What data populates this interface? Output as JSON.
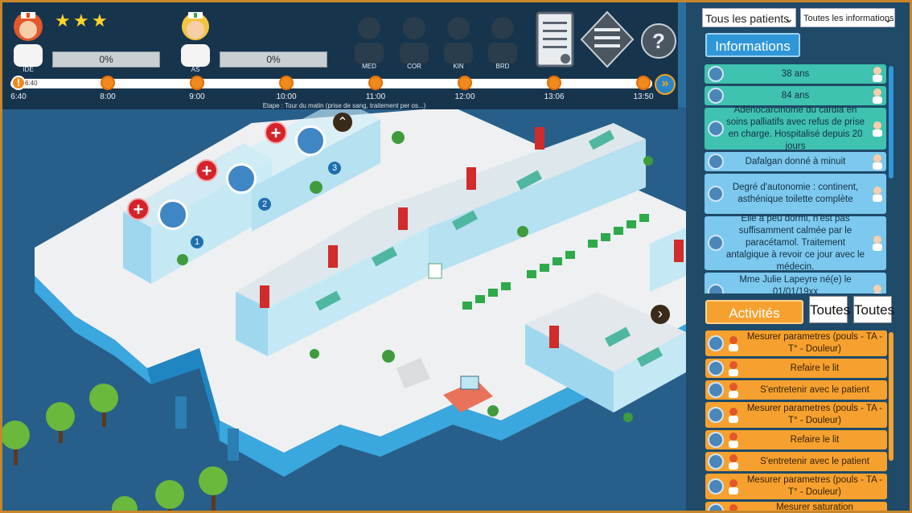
{
  "hud": {
    "staff": [
      {
        "code": "IDE",
        "progress": "0%"
      },
      {
        "code": "AS",
        "progress": "0%"
      }
    ],
    "stars": [
      "★",
      "★",
      "★"
    ],
    "consultants": [
      "MED",
      "COR",
      "KIN",
      "BRD"
    ],
    "icons": [
      "checklist-icon",
      "list-diamond-icon",
      "help-icon"
    ],
    "help_label": "?",
    "timeline": {
      "current_marker": "!",
      "current_time": "6:40",
      "ticks": [
        "6:40",
        "8:00",
        "9:00",
        "10:00",
        "11:00",
        "12:00",
        "13:06",
        "13:50"
      ],
      "stage": "Etape : Tour du matin (prise de sang, traitement per os...)"
    },
    "fast_forward": "»"
  },
  "game": {
    "room_numbers": [
      "1",
      "2",
      "3"
    ],
    "scroll_up": "⌃",
    "scroll_right": "›",
    "colors": {
      "water": "#2c6f9e",
      "floor": "#f0f2f3",
      "wall": "#7ec8e3",
      "chair": "#2eaa4a"
    }
  },
  "panel": {
    "patient_filter": "Tous les patients",
    "info_filter": "Toutes les informations",
    "info_tab": "Informations",
    "info_items": [
      {
        "text": "38 ans",
        "color": "#3fc2b0"
      },
      {
        "text": "84 ans",
        "color": "#3fc2b0"
      },
      {
        "text": "Adénocarcinome du cardia en soins palliatifs avec refus de prise en charge. Hospitalisé depuis 20 jours",
        "color": "#3fc2b0"
      },
      {
        "text": "Dafalgan donné à minuit",
        "color": "#7cc8ee"
      },
      {
        "text": "Degré d'autonomie : continent, asthénique toilette complète",
        "color": "#7cc8ee"
      },
      {
        "text": "Elle a peu dormi, n'est pas suffisamment calmée par le paracétamol. Traitement antalgique à revoir ce jour avec le médecin.",
        "color": "#7cc8ee"
      },
      {
        "text": "Mme Julie Lapeyre né(e) le 01/01/19xx",
        "color": "#7cc8ee"
      }
    ],
    "activities_tab": "Activités",
    "activities_filter_1": "Toutes",
    "activities_filter_2": "Toutes",
    "activities": [
      "Mesurer parametres (pouls - TA - T° - Douleur)",
      "Refaire le lit",
      "S'entretenir avec le patient",
      "Mesurer parametres (pouls - TA - T° - Douleur)",
      "Refaire le lit",
      "S'entretenir avec le patient",
      "Mesurer parametres (pouls - TA - T° - Douleur)",
      "Mesurer saturation"
    ]
  }
}
